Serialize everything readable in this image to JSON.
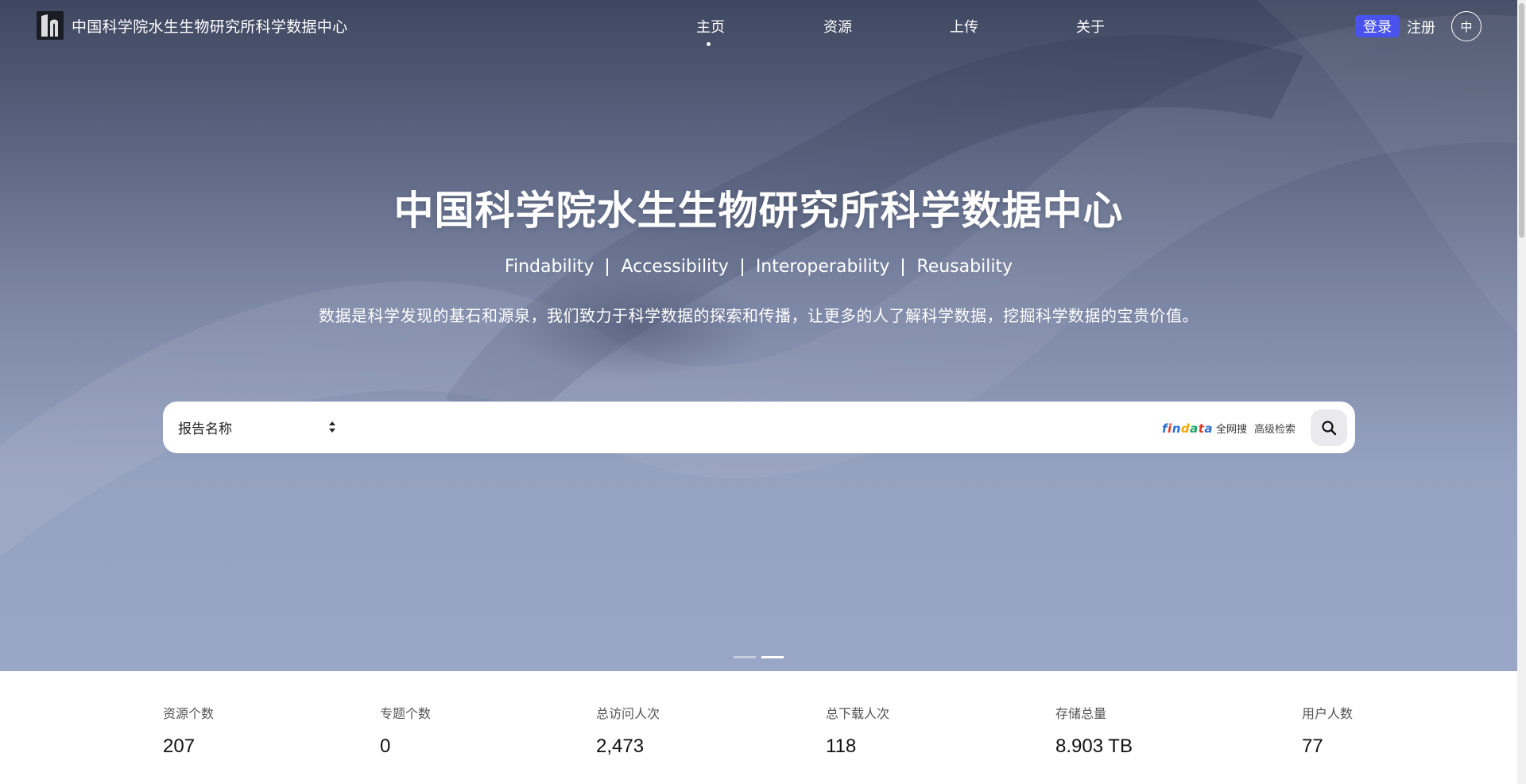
{
  "header": {
    "site_name": "中国科学院水生生物研究所科学数据中心",
    "nav": [
      {
        "label": "主页",
        "active": true
      },
      {
        "label": "资源",
        "active": false
      },
      {
        "label": "上传",
        "active": false
      },
      {
        "label": "关于",
        "active": false
      }
    ],
    "login_label": "登录",
    "register_label": "注册",
    "lang_label": "中",
    "accent_color": "#4a52ee"
  },
  "hero": {
    "title": "中国科学院水生生物研究所科学数据中心",
    "fair": [
      "Findability",
      "Accessibility",
      "Interoperability",
      "Reusability"
    ],
    "slogan": "数据是科学发现的基石和源泉，我们致力于科学数据的探索和传播，让更多的人了解科学数据，挖掘科学数据的宝贵价值。",
    "carousel_slides": 2,
    "carousel_active": 1
  },
  "search": {
    "field_selected": "报告名称",
    "placeholder": "",
    "findata_logo": "findata",
    "findata_label": "全网搜",
    "advanced_label": "高级检索",
    "search_icon": "search-icon"
  },
  "stats": [
    {
      "label": "资源个数",
      "value": "207"
    },
    {
      "label": "专题个数",
      "value": "0"
    },
    {
      "label": "总访问人次",
      "value": "2,473"
    },
    {
      "label": "总下载人次",
      "value": "118"
    },
    {
      "label": "存储总量",
      "value": "8.903 TB"
    },
    {
      "label": "用户人数",
      "value": "77"
    }
  ]
}
